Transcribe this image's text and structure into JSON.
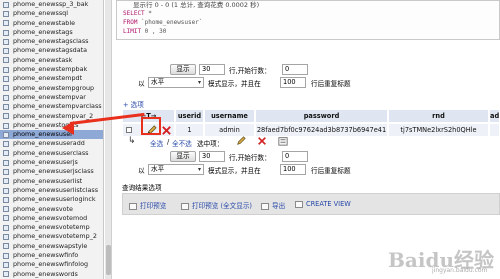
{
  "sidebar": {
    "items": [
      {
        "label": "phome_enewssp_3_bak",
        "active": false
      },
      {
        "label": "phome_enewssql",
        "active": false
      },
      {
        "label": "phome_enewstable",
        "active": false
      },
      {
        "label": "phome_enewstags",
        "active": false
      },
      {
        "label": "phome_enewstagsclass",
        "active": false
      },
      {
        "label": "phome_enewstagsdata",
        "active": false
      },
      {
        "label": "phome_enewstask",
        "active": false
      },
      {
        "label": "phome_enewstempbak",
        "active": false
      },
      {
        "label": "phome_enewstempdt",
        "active": false
      },
      {
        "label": "phome_enewstempgroup",
        "active": false
      },
      {
        "label": "phome_enewstempvar",
        "active": false
      },
      {
        "label": "phome_enewstempvarclass",
        "active": false
      },
      {
        "label": "phome_enewstempvar_2",
        "active": false
      },
      {
        "label": "phome_enewstogzts",
        "active": false
      },
      {
        "label": "phome_enewsuser",
        "active": true
      },
      {
        "label": "phome_enewsuseradd",
        "active": false
      },
      {
        "label": "phome_enewsuserclass",
        "active": false
      },
      {
        "label": "phome_enewsuserjs",
        "active": false
      },
      {
        "label": "phome_enewsuserjsclass",
        "active": false
      },
      {
        "label": "phome_enewsuserlist",
        "active": false
      },
      {
        "label": "phome_enewsuserlistclass",
        "active": false
      },
      {
        "label": "phome_enewsuserloginck",
        "active": false
      },
      {
        "label": "phome_enewsvote",
        "active": false
      },
      {
        "label": "phome_enewsvotemod",
        "active": false
      },
      {
        "label": "phome_enewsvotetemp",
        "active": false
      },
      {
        "label": "phome_enewsvotetemp_2",
        "active": false
      },
      {
        "label": "phome_enewswapstyle",
        "active": false
      },
      {
        "label": "phome_enewswfinfo",
        "active": false
      },
      {
        "label": "phome_enewswfinfolog",
        "active": false
      },
      {
        "label": "phome_enewswords",
        "active": false
      }
    ]
  },
  "query": {
    "status_line": "显示行 0 - 0 (1 总计, 查询花费 0.0002 秒)",
    "line1_kw": "SELECT",
    "line1_rest": " *",
    "line2_kw": "FROM",
    "line2_rest": " `phome_enewsuser`",
    "line3_kw": "LIMIT",
    "line3_rest": " 0 , 30"
  },
  "nav_top": {
    "show_button": "显示",
    "count_value": "30",
    "start_label": "行,开始行数：",
    "start_value": "0",
    "mode_prefix": "以",
    "mode_value": "水平",
    "mode_label": "模式显示，并且在",
    "repeat_value": "100",
    "repeat_label": "行后重复标题"
  },
  "options_link": "+ 选项",
  "table": {
    "headers": [
      "←T→",
      "userid",
      "username",
      "password",
      "rnd",
      "ad"
    ],
    "row": [
      "",
      "1",
      "admin",
      "28faed7bf0c97624ad3b8737b6947e41",
      "tj7sTMNe2lxrS2h0QHle",
      ""
    ]
  },
  "bulk": {
    "check_all": "全选",
    "uncheck_all": "全不选",
    "selected_label": "选中项："
  },
  "nav_bottom": {
    "show_button": "显示",
    "count_value": "30",
    "start_label": "行,开始行数：",
    "start_value": "0",
    "mode_prefix": "以",
    "mode_value": "水平",
    "mode_label": "模式显示，并且在",
    "repeat_value": "100",
    "repeat_label": "行后重复标题"
  },
  "ops": {
    "title": "查询结果选项",
    "items": [
      "打印预览",
      "打印预览 (全文显示)",
      "导出",
      "CREATE VIEW"
    ]
  },
  "watermark": {
    "text": "Baidu经验",
    "sub": "jingyan.baidu.com"
  },
  "colors": {
    "arrow": "#e8301d",
    "header_bg": "#dfe6f1",
    "row_bg": "#eef2f8",
    "active_table": "#8fa9d6",
    "sql_keyword": "#b0126a",
    "link": "#2647a8"
  }
}
